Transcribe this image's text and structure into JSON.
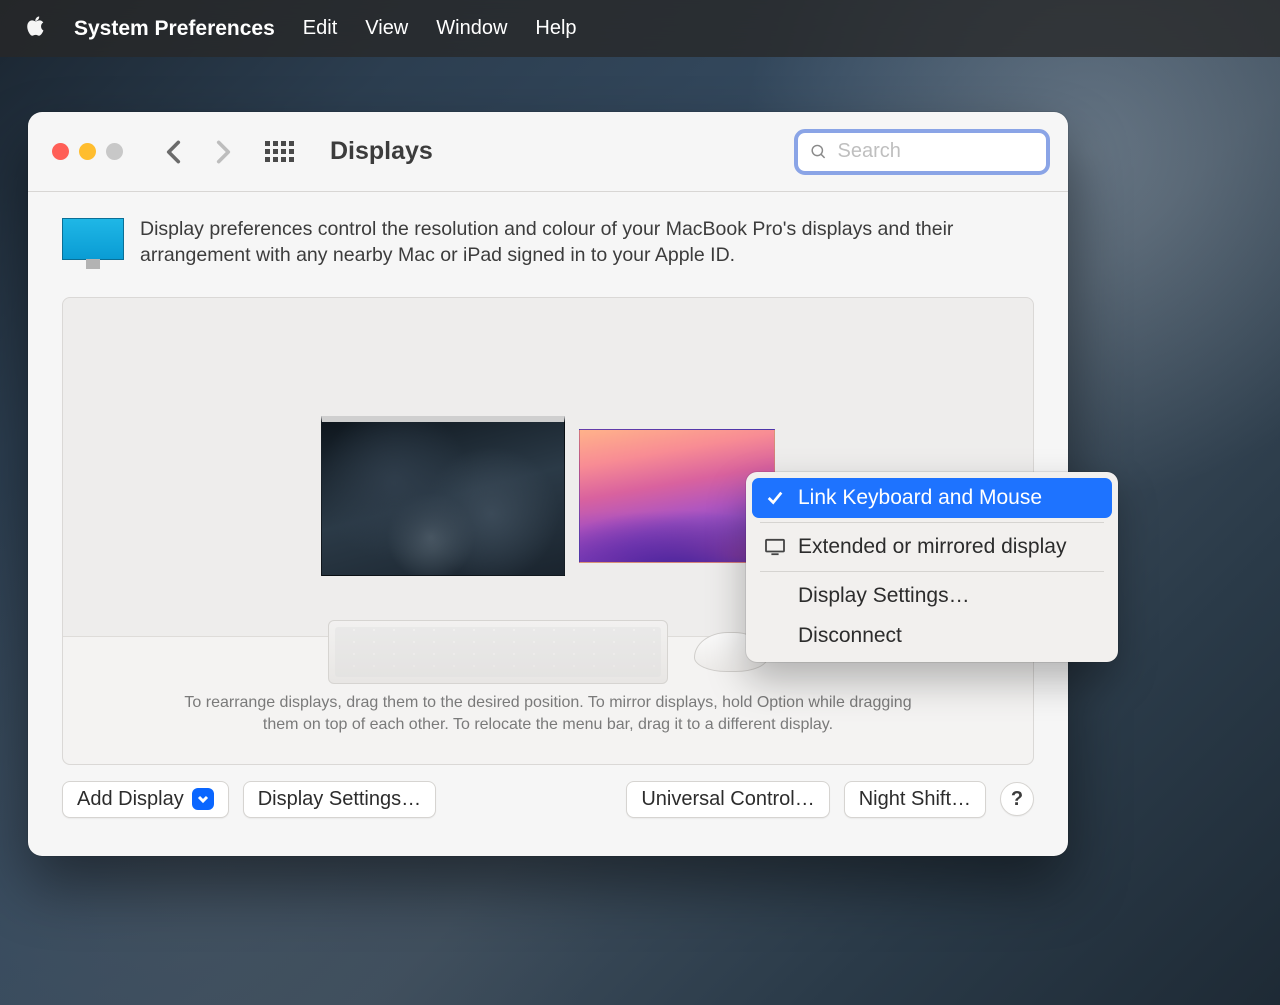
{
  "menubar": {
    "app_name": "System Preferences",
    "items": [
      "Edit",
      "View",
      "Window",
      "Help"
    ]
  },
  "window": {
    "title": "Displays",
    "search_placeholder": "Search"
  },
  "intro": "Display preferences control the resolution and colour of your MacBook Pro's displays and their arrangement with any nearby Mac or iPad signed in to your Apple ID.",
  "hints_line1": "To rearrange displays, drag them to the desired position. To mirror displays, hold Option while dragging",
  "hints_line2": "them on top of each other. To relocate the menu bar, drag it to a different display.",
  "popover": {
    "item_link": "Link Keyboard and Mouse",
    "item_extended": "Extended or mirrored display",
    "item_settings": "Display Settings…",
    "item_disconnect": "Disconnect"
  },
  "footer": {
    "add_display": "Add Display",
    "display_settings": "Display Settings…",
    "universal_control": "Universal Control…",
    "night_shift": "Night Shift…",
    "help": "?"
  }
}
